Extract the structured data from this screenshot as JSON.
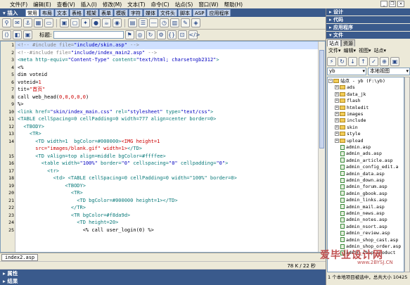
{
  "menu": [
    "文件(F)",
    "编辑(E)",
    "查看(V)",
    "插入(I)",
    "修改(M)",
    "文本(T)",
    "命令(C)",
    "站点(S)",
    "窗口(W)",
    "帮助(H)"
  ],
  "insert_bar": {
    "title": "▾ 插入",
    "tabs": [
      "常用",
      "布局",
      "文本",
      "表格",
      "框架",
      "表单",
      "模板",
      "字符",
      "媒体",
      "文件头",
      "脚本",
      "ASP",
      "应用程序"
    ]
  },
  "doc_toolbar": {
    "title_label": "标题:",
    "title_value": ""
  },
  "code_lines": [
    {
      "n": "1",
      "segs": [
        [
          "gray",
          "<!-- #include file="
        ],
        [
          "blue",
          "\"include/skin.asp\""
        ],
        [
          "gray",
          " -->"
        ]
      ]
    },
    {
      "n": "2",
      "segs": [
        [
          "gray",
          "<!--#include file="
        ],
        [
          "blue",
          "\"include/index_main2.asp\""
        ],
        [
          "gray",
          " -->"
        ]
      ]
    },
    {
      "n": "3",
      "segs": [
        [
          "teal",
          "<meta http-equiv="
        ],
        [
          "blue",
          "\"Content-Type\""
        ],
        [
          "teal",
          " content="
        ],
        [
          "blue",
          "\"text/html; charset=gb2312\""
        ],
        [
          "teal",
          ">"
        ]
      ]
    },
    {
      "n": "4",
      "segs": [
        [
          "",
          "<%"
        ]
      ]
    },
    {
      "n": "5",
      "segs": [
        [
          "",
          "dim voteid"
        ]
      ]
    },
    {
      "n": "6",
      "segs": [
        [
          "",
          "voteid="
        ],
        [
          "red",
          "1"
        ]
      ]
    },
    {
      "n": "7",
      "segs": [
        [
          "",
          "tit="
        ],
        [
          "red",
          "\"首页\""
        ]
      ]
    },
    {
      "n": "8",
      "segs": [
        [
          "",
          "call web_head("
        ],
        [
          "red",
          "0,0,0,0,0"
        ],
        [
          "",
          ")"
        ]
      ]
    },
    {
      "n": "9",
      "segs": [
        [
          "",
          "%>"
        ]
      ]
    },
    {
      "n": "10",
      "segs": [
        [
          "teal",
          "<link href="
        ],
        [
          "blue",
          "\"skin/index_main.css\""
        ],
        [
          "teal",
          " rel="
        ],
        [
          "blue",
          "\"stylesheet\""
        ],
        [
          "teal",
          " type="
        ],
        [
          "blue",
          "\"text/css\""
        ],
        [
          "teal",
          ">"
        ]
      ]
    },
    {
      "n": "11",
      "segs": [
        [
          "teal",
          "<TABLE cellSpacing=0 cellPadding=0 width=777 align=center border=0>"
        ]
      ]
    },
    {
      "n": "12",
      "segs": [
        [
          "teal",
          "  <TBODY>"
        ]
      ]
    },
    {
      "n": "13",
      "segs": [
        [
          "teal",
          "    <TR>"
        ]
      ]
    },
    {
      "n": "14",
      "segs": [
        [
          "teal",
          "      <TD width=1  bgColor=#000000>"
        ],
        [
          "red",
          "<IMG height=1"
        ]
      ]
    },
    {
      "n": "",
      "segs": [
        [
          "red",
          "      src=\"images/blank.gif\" width=1>"
        ],
        [
          "teal",
          "</TD>"
        ]
      ]
    },
    {
      "n": "15",
      "segs": [
        [
          "teal",
          "      <TD vAlign=top align=middle bgColor=#ffffee>"
        ]
      ]
    },
    {
      "n": "16",
      "segs": [
        [
          "teal",
          "        <table width="
        ],
        [
          "blue",
          "\"100%\""
        ],
        [
          "teal",
          " border="
        ],
        [
          "blue",
          "\"0\""
        ],
        [
          "teal",
          " cellspacing="
        ],
        [
          "blue",
          "\"0\""
        ],
        [
          "teal",
          " cellpadding="
        ],
        [
          "blue",
          "\"0\""
        ],
        [
          "teal",
          ">"
        ]
      ]
    },
    {
      "n": "17",
      "segs": [
        [
          "teal",
          "          <tr>"
        ]
      ]
    },
    {
      "n": "18",
      "segs": [
        [
          "teal",
          "            <td> <TABLE cellSpacing=0 cellPadding=0 width=\"100%\" border=0>"
        ]
      ]
    },
    {
      "n": "19",
      "segs": [
        [
          "teal",
          "                <TBODY>"
        ]
      ]
    },
    {
      "n": "20",
      "segs": [
        [
          "teal",
          "                  <TR>"
        ]
      ]
    },
    {
      "n": "21",
      "segs": [
        [
          "teal",
          "                    <TD bgColor=#000000 height=1></TD>"
        ]
      ]
    },
    {
      "n": "22",
      "segs": [
        [
          "teal",
          "                  </TR>"
        ]
      ]
    },
    {
      "n": "23",
      "segs": [
        [
          "teal",
          "                  <TR bgColor=#f8da9d>"
        ]
      ]
    },
    {
      "n": "24",
      "segs": [
        [
          "teal",
          "                    <TD height=20>"
        ]
      ]
    },
    {
      "n": "25",
      "segs": [
        [
          "",
          "                      <% call user_login(0) %>"
        ]
      ]
    }
  ],
  "doc_tab": "index2.asp",
  "status": "78 K / 22 秒",
  "bottom_panels": [
    "▸ 属性",
    "▸ 结果"
  ],
  "right_panel": {
    "sections": [
      "▸ 设计",
      "▸ 代码",
      "▸ 应用程序",
      "▾ 文件"
    ],
    "tabs": [
      "站点",
      "资源"
    ],
    "menus": [
      "文件▾",
      "编辑▾",
      "视图▾",
      "站点▾"
    ],
    "site_select": "yb",
    "view_select": "本地视图",
    "tree_root": "站点 - yb (F:\\yb)",
    "folders": [
      "ads",
      "data_jk",
      "flash",
      "htmledit",
      "images",
      "include",
      "skin",
      "style",
      "upload"
    ],
    "files": [
      "admin.asp",
      "admin_ads.asp",
      "admin_article.asp",
      "admin_config_edit.a",
      "admin_data.asp",
      "admin_down.asp",
      "admin_forum.asp",
      "admin_gbook.asp",
      "admin_links.asp",
      "admin_mail.asp",
      "admin_news.asp",
      "admin_notes.asp",
      "admin_nsort.asp",
      "admin_review.asp",
      "admin_shop_cast.asp",
      "admin_shop_order.asp",
      "admin_shop_product"
    ],
    "footer": "1 个本地项目被选中，总共大小 10425"
  },
  "watermark": "爱毕业设计网",
  "watermark_url": "www.2BYSJ.CN"
}
